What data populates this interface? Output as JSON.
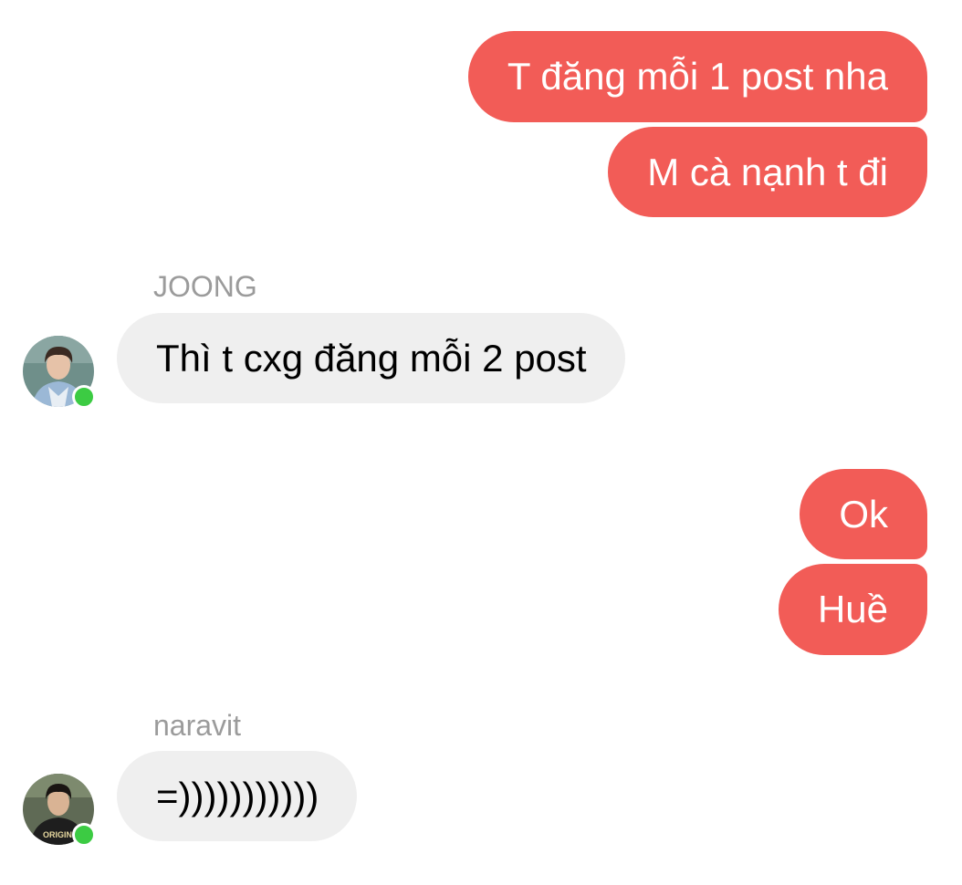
{
  "colors": {
    "outgoing_bubble": "#f25c57",
    "incoming_bubble": "#efefef",
    "sender_name": "#9b9b9b",
    "online_indicator": "#3ccb43"
  },
  "messages": [
    {
      "direction": "out",
      "text": "T đăng mỗi 1 post nha"
    },
    {
      "direction": "out",
      "text": "M cà nạnh t đi"
    },
    {
      "direction": "in",
      "sender": "JOONG",
      "text": "Thì t cxg đăng mỗi 2 post",
      "avatar_icon": "user-avatar-joong",
      "online": true
    },
    {
      "direction": "out",
      "text": "Ok"
    },
    {
      "direction": "out",
      "text": "Huề"
    },
    {
      "direction": "in",
      "sender": "naravit",
      "text": "=)))))))))))",
      "avatar_icon": "user-avatar-naravit",
      "online": true
    }
  ]
}
